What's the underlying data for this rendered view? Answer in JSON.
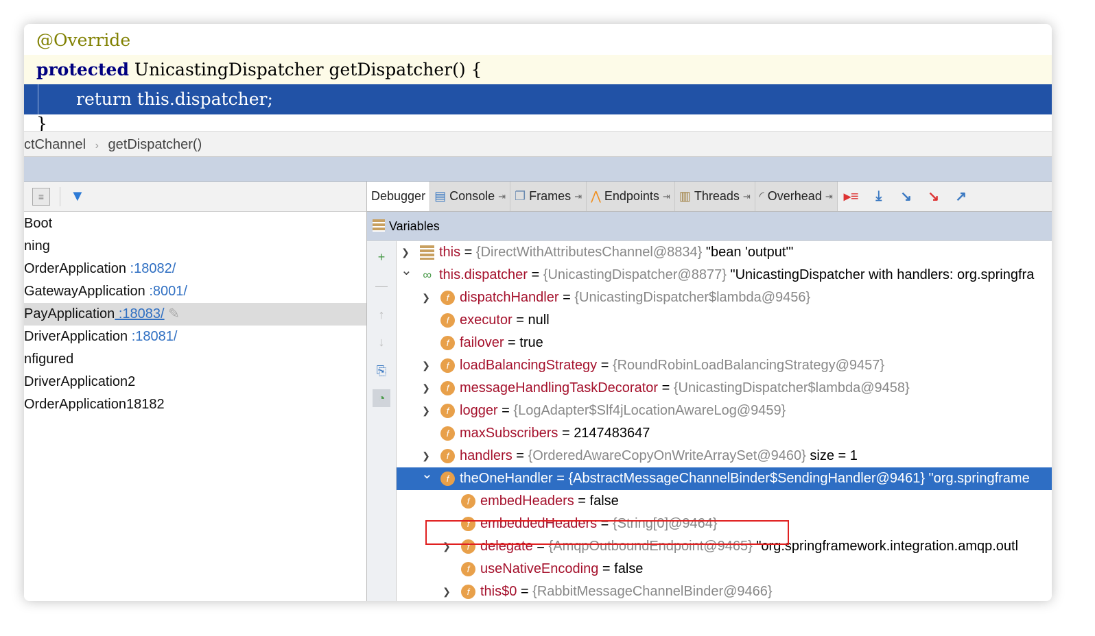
{
  "editor": {
    "annotation": "@Override",
    "keyword": "protected",
    "signature": " UnicastingDispatcher getDispatcher() {",
    "current_line": "return this.dispatcher;",
    "closing": "}"
  },
  "breadcrumb": {
    "items": [
      "ctChannel",
      "getDispatcher()"
    ],
    "separator": "›"
  },
  "left_panel": {
    "items": [
      {
        "name": "Boot",
        "port": ""
      },
      {
        "name": "ning",
        "port": ""
      },
      {
        "name": "OrderApplication",
        "port": " :18082/"
      },
      {
        "name": "GatewayApplication",
        "port": " :8001/"
      },
      {
        "name": "PayApplication",
        "port": " :18083/",
        "selected": true
      },
      {
        "name": "DriverApplication",
        "port": " :18081/"
      },
      {
        "name": "nfigured",
        "port": ""
      },
      {
        "name": "DriverApplication2",
        "port": ""
      },
      {
        "name": "OrderApplication18182",
        "port": ""
      }
    ]
  },
  "tabs": [
    {
      "label": "Debugger",
      "active": true
    },
    {
      "label": "Console",
      "icon": "console-icon"
    },
    {
      "label": "Frames",
      "icon": "frames-icon"
    },
    {
      "label": "Endpoints",
      "icon": "endpoints-icon"
    },
    {
      "label": "Threads",
      "icon": "threads-icon"
    },
    {
      "label": "Overhead",
      "icon": "overhead-icon"
    }
  ],
  "pin_glyph": "⇥",
  "variables_title": "Variables",
  "variables": [
    {
      "level": 0,
      "arrow": "›",
      "icon": "list",
      "name": "this",
      "eq": " = ",
      "obj": "{DirectWithAttributesChannel@8834}",
      "val": " \"bean 'output'\""
    },
    {
      "level": 0,
      "arrow": "⌄",
      "icon": "glasses",
      "name": "this.dispatcher",
      "eq": " = ",
      "obj": "{UnicastingDispatcher@8877}",
      "val": " \"UnicastingDispatcher with handlers: org.springfra"
    },
    {
      "level": 1,
      "arrow": "›",
      "icon": "f",
      "name": "dispatchHandler",
      "eq": " = ",
      "obj": "{UnicastingDispatcher$lambda@9456}",
      "val": ""
    },
    {
      "level": 1,
      "arrow": "",
      "icon": "f",
      "name": "executor",
      "eq": " = ",
      "obj": "",
      "val": "null"
    },
    {
      "level": 1,
      "arrow": "",
      "icon": "f",
      "name": "failover",
      "eq": " = ",
      "obj": "",
      "val": "true"
    },
    {
      "level": 1,
      "arrow": "›",
      "icon": "f",
      "name": "loadBalancingStrategy",
      "eq": " = ",
      "obj": "{RoundRobinLoadBalancingStrategy@9457}",
      "val": ""
    },
    {
      "level": 1,
      "arrow": "›",
      "icon": "f",
      "name": "messageHandlingTaskDecorator",
      "eq": " = ",
      "obj": "{UnicastingDispatcher$lambda@9458}",
      "val": ""
    },
    {
      "level": 1,
      "arrow": "›",
      "icon": "f",
      "name": "logger",
      "eq": " = ",
      "obj": "{LogAdapter$Slf4jLocationAwareLog@9459}",
      "val": ""
    },
    {
      "level": 1,
      "arrow": "",
      "icon": "f",
      "name": "maxSubscribers",
      "eq": " = ",
      "obj": "",
      "val": "2147483647"
    },
    {
      "level": 1,
      "arrow": "›",
      "icon": "f",
      "name": "handlers",
      "eq": " = ",
      "obj": "{OrderedAwareCopyOnWriteArraySet@9460}",
      "val": "  size = 1"
    },
    {
      "level": 1,
      "arrow": "⌄",
      "icon": "f",
      "name": "theOneHandler",
      "eq": " = ",
      "obj": "{AbstractMessageChannelBinder$SendingHandler@9461}",
      "val": " \"org.springframe",
      "selected": true
    },
    {
      "level": 2,
      "arrow": "",
      "icon": "f",
      "name": "embedHeaders",
      "eq": " = ",
      "obj": "",
      "val": "false"
    },
    {
      "level": 2,
      "arrow": "",
      "icon": "f",
      "name": "embeddedHeaders",
      "eq": " = ",
      "obj": "{String[0]@9464}",
      "val": ""
    },
    {
      "level": 2,
      "arrow": "›",
      "icon": "f",
      "name": "delegate",
      "eq": " = ",
      "obj": "{AmqpOutboundEndpoint@9465}",
      "val": " \"org.springframework.integration.amqp.outl"
    },
    {
      "level": 2,
      "arrow": "",
      "icon": "f",
      "name": "useNativeEncoding",
      "eq": " = ",
      "obj": "",
      "val": "false"
    },
    {
      "level": 2,
      "arrow": "›",
      "icon": "f",
      "name": "this$0",
      "eq": " = ",
      "obj": "{RabbitMessageChannelBinder@9466}",
      "val": "",
      "highlighted": true
    }
  ],
  "colors": {
    "current_line": "#2152a6",
    "selection": "#2e6ec4",
    "field_name": "#a5112c",
    "highlight_box": "#e02020"
  }
}
